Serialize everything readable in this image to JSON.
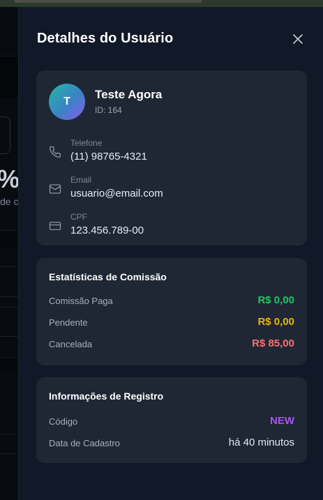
{
  "drawer": {
    "title": "Detalhes do Usuário"
  },
  "user": {
    "initial": "T",
    "name": "Teste Agora",
    "id_text": "ID: 164",
    "fields": [
      {
        "label": "Telefone",
        "value": "(11) 98765-4321",
        "icon": "phone-icon"
      },
      {
        "label": "Email",
        "value": "usuario@email.com",
        "icon": "mail-icon"
      },
      {
        "label": "CPF",
        "value": "123.456.789-00",
        "icon": "card-icon"
      }
    ]
  },
  "stats": {
    "title": "Estatísticas de Comissão",
    "rows": [
      {
        "label": "Comissão Paga",
        "value": "R$ 0,00",
        "color": "#22c55e"
      },
      {
        "label": "Pendente",
        "value": "R$ 0,00",
        "color": "#eab308"
      },
      {
        "label": "Cancelada",
        "value": "R$ 85,00",
        "color": "#f87171"
      }
    ]
  },
  "registration": {
    "title": "Informações de Registro",
    "rows": [
      {
        "label": "Código",
        "value": "NEW",
        "color": "#a855f7"
      },
      {
        "label": "Data de Cadastro",
        "value": "há 40 minutos",
        "color": "#e6e9ef"
      }
    ]
  },
  "background": {
    "big_value": "%",
    "sub_text": "de c"
  }
}
